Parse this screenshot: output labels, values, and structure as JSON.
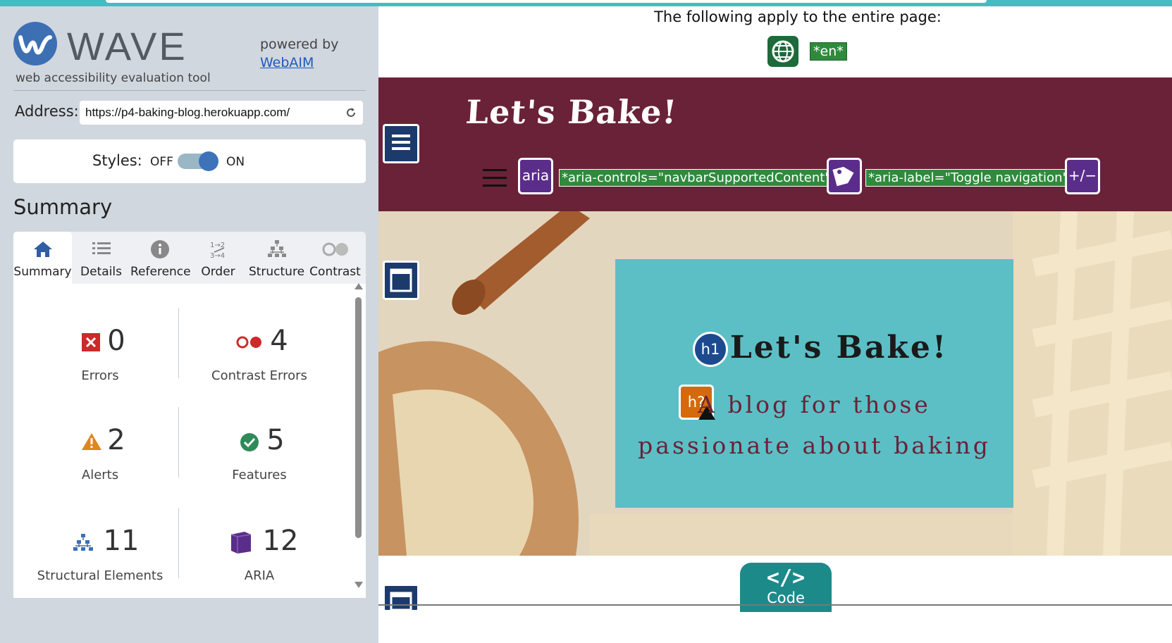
{
  "wave": {
    "title": "WAVE",
    "subtitle": "web accessibility evaluation tool",
    "powered_by": "powered by",
    "webaim_link": "WebAIM",
    "address_label": "Address:",
    "address_value": "https://p4-baking-blog.herokuapp.com/",
    "styles_label": "Styles:",
    "styles_off": "OFF",
    "styles_on": "ON",
    "summary_heading": "Summary",
    "tabs": [
      {
        "label": "Summary",
        "icon": "home-icon",
        "active": true
      },
      {
        "label": "Details",
        "icon": "list-icon",
        "active": false
      },
      {
        "label": "Reference",
        "icon": "info-icon",
        "active": false
      },
      {
        "label": "Order",
        "icon": "order-icon",
        "active": false
      },
      {
        "label": "Structure",
        "icon": "hierarchy-icon",
        "active": false
      },
      {
        "label": "Contrast",
        "icon": "contrast-icon",
        "active": false
      }
    ],
    "stats": [
      {
        "value": "0",
        "label": "Errors",
        "icon": "error-icon",
        "color": "#cc2a2a"
      },
      {
        "value": "4",
        "label": "Contrast Errors",
        "icon": "contrast-error-icon",
        "color": "#cc2a2a"
      },
      {
        "value": "2",
        "label": "Alerts",
        "icon": "alert-icon",
        "color": "#e0861b"
      },
      {
        "value": "5",
        "label": "Features",
        "icon": "feature-check-icon",
        "color": "#2f8a5a"
      },
      {
        "value": "11",
        "label": "Structural Elements",
        "icon": "structure-icon",
        "color": "#3d6fb3"
      },
      {
        "value": "12",
        "label": "ARIA",
        "icon": "aria-cube-icon",
        "color": "#5b2d8a"
      }
    ]
  },
  "page": {
    "entire_page_note": "The following apply to the entire page:",
    "lang_badge": "*en*",
    "brand": "Let's Bake!",
    "aria_badge": "aria",
    "aria_controls_label": "*aria-controls=\"navbarSupportedContent\"*",
    "aria_label_label": "*aria-label=\"Toggle navigation\"*",
    "aria_expanded_badge": "+/−",
    "hero_title": "Let's Bake!",
    "hero_subtitle": "A blog for those passionate about baking",
    "h1_badge": "h1",
    "h2_badge": "h?",
    "code_glyph": "</>",
    "code_label": "Code"
  },
  "colors": {
    "sidebar_bg": "#d1d7df",
    "navbar_bg": "#6a2238",
    "hero_box": "#5cbfc5",
    "accent_teal": "#1d8a8a"
  }
}
